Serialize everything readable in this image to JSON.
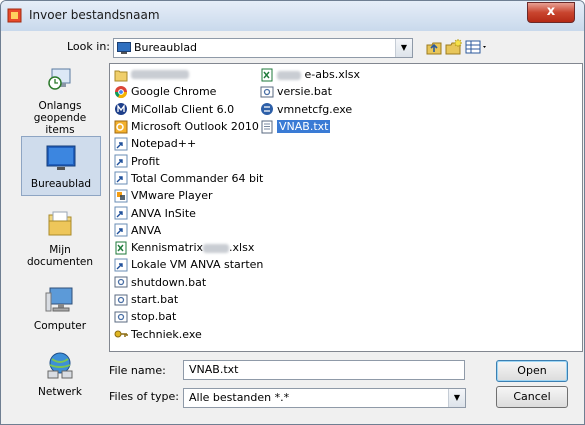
{
  "window": {
    "title": "Invoer bestandsnaam",
    "close_glyph": "x"
  },
  "lookin": {
    "label": "Look in:",
    "value": "Bureaublad",
    "icon": "desktop-icon"
  },
  "places": [
    {
      "label_lines": [
        "Onlangs",
        "geopende",
        "items"
      ],
      "icon": "recent-items-icon"
    },
    {
      "label_lines": [
        "Bureaublad"
      ],
      "icon": "desktop-icon",
      "selected": true
    },
    {
      "label_lines": [
        "Mijn",
        "documenten"
      ],
      "icon": "folder-icon"
    },
    {
      "label_lines": [
        "Computer"
      ],
      "icon": "computer-icon"
    },
    {
      "label_lines": [
        "Netwerk"
      ],
      "icon": "network-icon"
    }
  ],
  "files_col1": [
    {
      "name": "",
      "icon": "user-folder-icon",
      "redacted": true
    },
    {
      "name": "Google Chrome",
      "icon": "chrome-shortcut-icon"
    },
    {
      "name": "MiCollab Client 6.0",
      "icon": "micollab-shortcut-icon"
    },
    {
      "name": "Microsoft Outlook 2010",
      "icon": "outlook-shortcut-icon"
    },
    {
      "name": "Notepad++",
      "icon": "shortcut-icon"
    },
    {
      "name": "Profit",
      "icon": "shortcut-icon"
    },
    {
      "name": "Total Commander 64 bit",
      "icon": "shortcut-icon"
    },
    {
      "name": "VMware Player",
      "icon": "vmware-shortcut-icon"
    },
    {
      "name": "ANVA InSite",
      "icon": "shortcut-icon"
    },
    {
      "name": "ANVA",
      "icon": "shortcut-icon"
    },
    {
      "name": "Kennismatrix",
      "suffix": ".xlsx",
      "icon": "excel-file-icon",
      "partial_redacted": true
    },
    {
      "name": "Lokale VM ANVA starten",
      "icon": "shortcut-icon"
    },
    {
      "name": "shutdown.bat",
      "icon": "batch-file-icon"
    },
    {
      "name": "start.bat",
      "icon": "batch-file-icon"
    },
    {
      "name": "stop.bat",
      "icon": "batch-file-icon"
    },
    {
      "name": "Techniek.exe",
      "icon": "key-exe-icon"
    }
  ],
  "files_col2": [
    {
      "name": "e-abs.xlsx",
      "icon": "excel-file-icon",
      "prefix_redacted": true
    },
    {
      "name": "versie.bat",
      "icon": "batch-file-icon"
    },
    {
      "name": "vmnetcfg.exe",
      "icon": "vmnetcfg-exe-icon"
    },
    {
      "name": "VNAB.txt",
      "icon": "text-file-icon",
      "selected": true
    }
  ],
  "filename": {
    "label": "File name:",
    "value": "VNAB.txt"
  },
  "filetype": {
    "label": "Files of type:",
    "value": "Alle bestanden *.*"
  },
  "buttons": {
    "open": "Open",
    "cancel": "Cancel"
  }
}
